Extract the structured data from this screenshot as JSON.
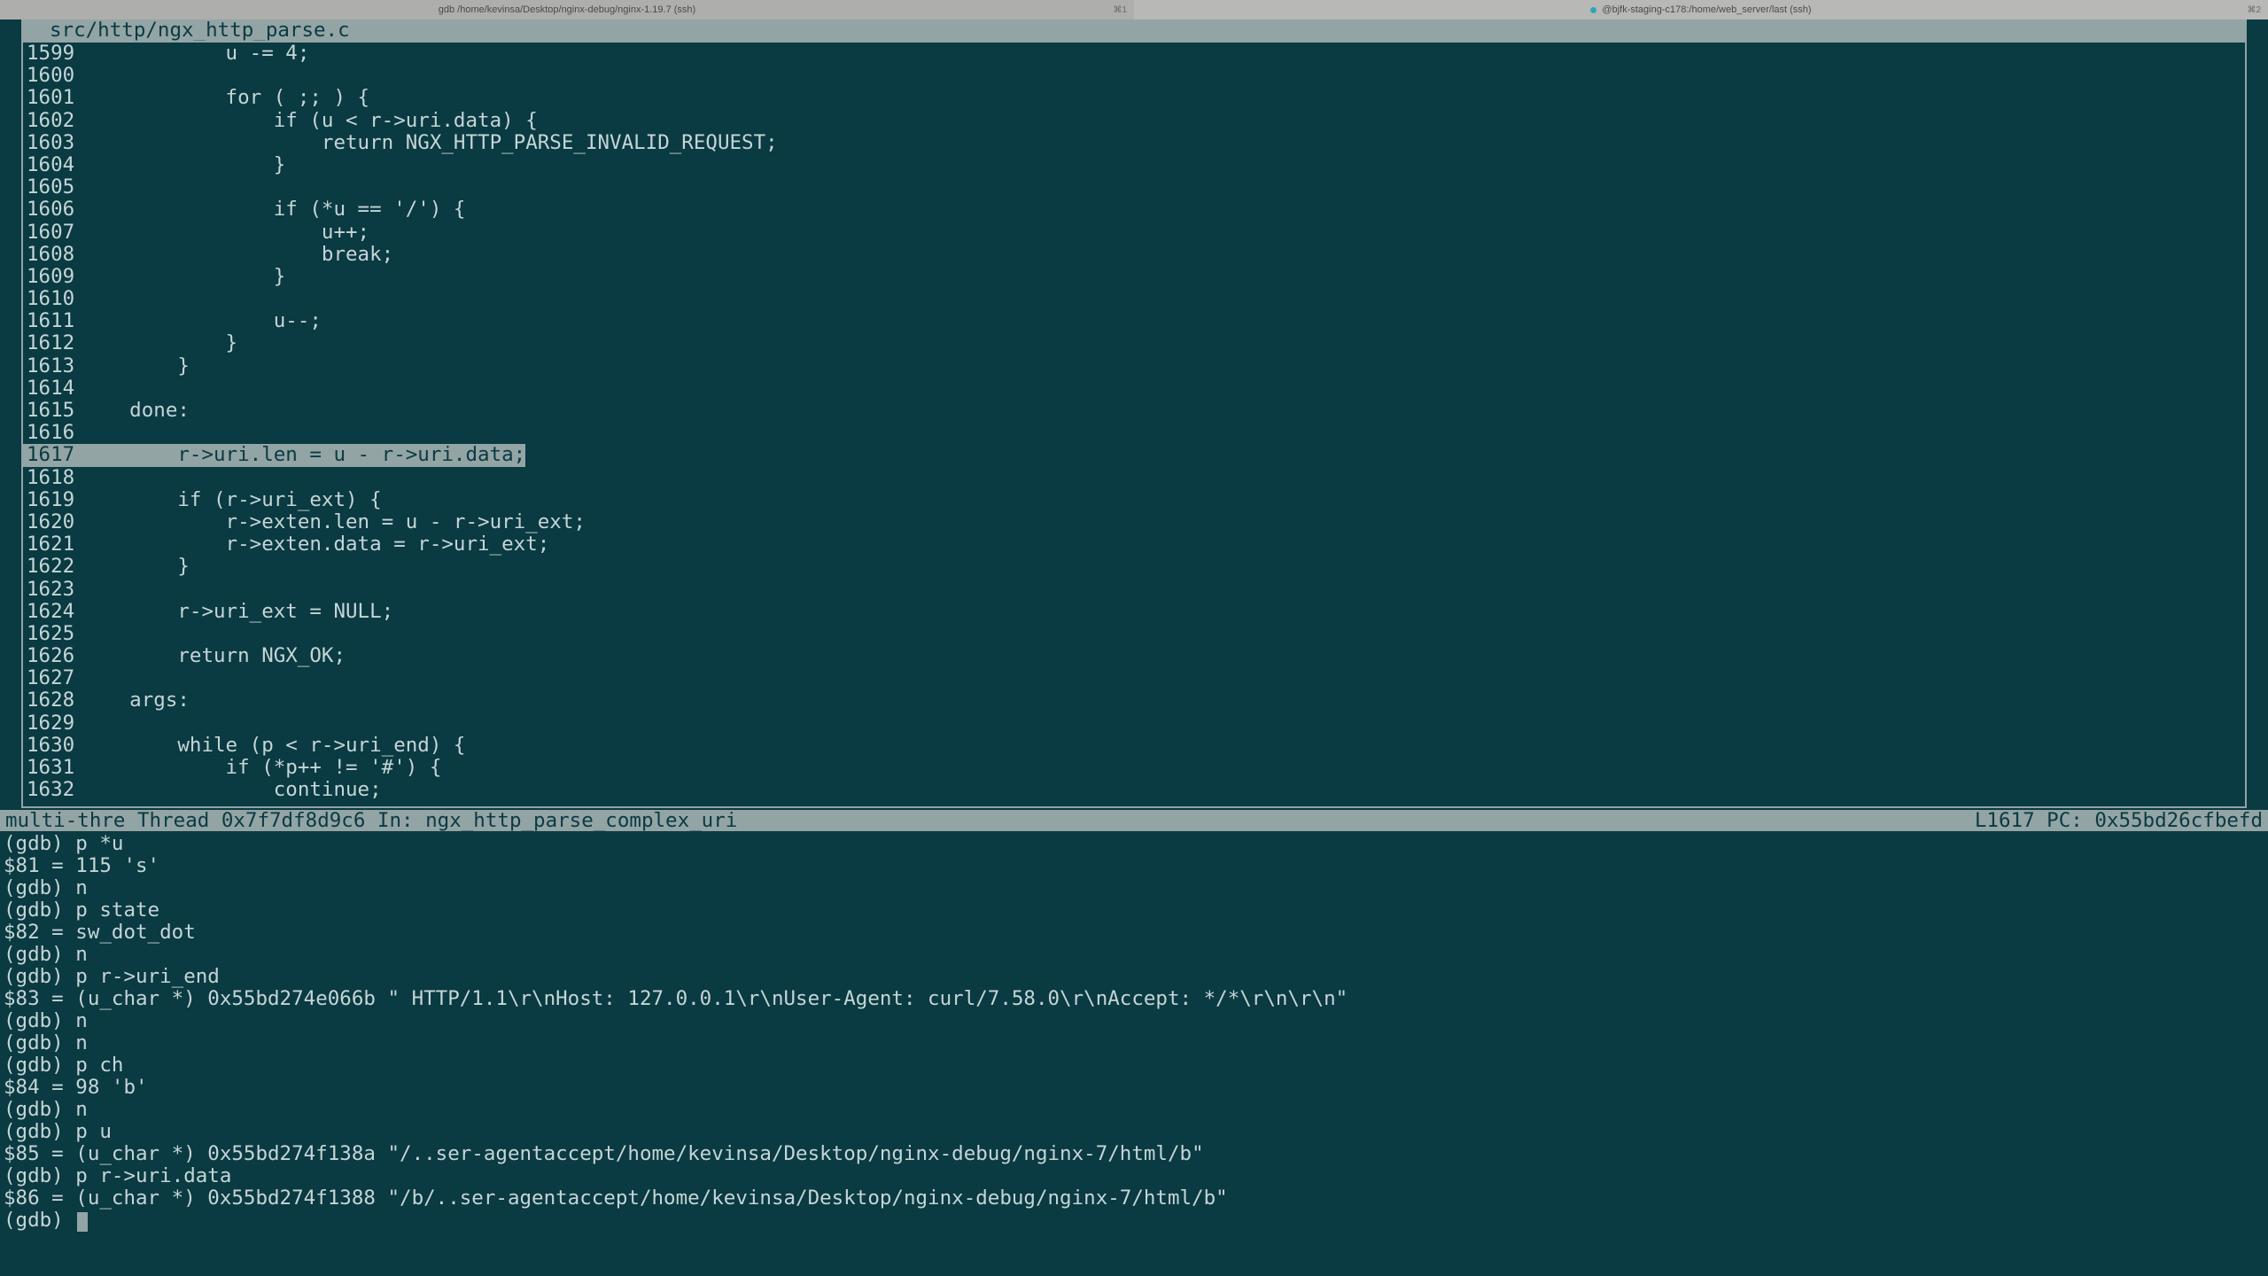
{
  "titlebar": {
    "tab1": {
      "label": "gdb  /home/kevinsa/Desktop/nginx-debug/nginx-1.19.7 (ssh)",
      "hotkey": "⌘1"
    },
    "tab2": {
      "label": "@bjfk-staging-c178:/home/web_server/last (ssh)",
      "hotkey": "⌘2"
    }
  },
  "source": {
    "path": "src/http/ngx_http_parse.c",
    "current_marker": ">",
    "lines": [
      {
        "num": "1599",
        "text": "            u -= 4;"
      },
      {
        "num": "1600",
        "text": ""
      },
      {
        "num": "1601",
        "text": "            for ( ;; ) {"
      },
      {
        "num": "1602",
        "text": "                if (u < r->uri.data) {"
      },
      {
        "num": "1603",
        "text": "                    return NGX_HTTP_PARSE_INVALID_REQUEST;"
      },
      {
        "num": "1604",
        "text": "                }"
      },
      {
        "num": "1605",
        "text": ""
      },
      {
        "num": "1606",
        "text": "                if (*u == '/') {"
      },
      {
        "num": "1607",
        "text": "                    u++;"
      },
      {
        "num": "1608",
        "text": "                    break;"
      },
      {
        "num": "1609",
        "text": "                }"
      },
      {
        "num": "1610",
        "text": ""
      },
      {
        "num": "1611",
        "text": "                u--;"
      },
      {
        "num": "1612",
        "text": "            }"
      },
      {
        "num": "1613",
        "text": "        }"
      },
      {
        "num": "1614",
        "text": ""
      },
      {
        "num": "1615",
        "text": "    done:"
      },
      {
        "num": "1616",
        "text": ""
      },
      {
        "num": "1617",
        "text": "        r->uri.len = u - r->uri.data;",
        "current": true
      },
      {
        "num": "1618",
        "text": ""
      },
      {
        "num": "1619",
        "text": "        if (r->uri_ext) {"
      },
      {
        "num": "1620",
        "text": "            r->exten.len = u - r->uri_ext;"
      },
      {
        "num": "1621",
        "text": "            r->exten.data = r->uri_ext;"
      },
      {
        "num": "1622",
        "text": "        }"
      },
      {
        "num": "1623",
        "text": ""
      },
      {
        "num": "1624",
        "text": "        r->uri_ext = NULL;"
      },
      {
        "num": "1625",
        "text": ""
      },
      {
        "num": "1626",
        "text": "        return NGX_OK;"
      },
      {
        "num": "1627",
        "text": ""
      },
      {
        "num": "1628",
        "text": "    args:"
      },
      {
        "num": "1629",
        "text": ""
      },
      {
        "num": "1630",
        "text": "        while (p < r->uri_end) {"
      },
      {
        "num": "1631",
        "text": "            if (*p++ != '#') {"
      },
      {
        "num": "1632",
        "text": "                continue;"
      }
    ]
  },
  "status": {
    "left": "multi-thre Thread 0x7f7df8d9c6 In: ngx_http_parse_complex_uri",
    "right": "L1617 PC: 0x55bd26cfbefd"
  },
  "console": [
    "(gdb) p *u",
    "$81 = 115 's'",
    "(gdb) n",
    "(gdb) p state",
    "$82 = sw_dot_dot",
    "(gdb) n",
    "(gdb) p r->uri_end",
    "$83 = (u_char *) 0x55bd274e066b \" HTTP/1.1\\r\\nHost: 127.0.0.1\\r\\nUser-Agent: curl/7.58.0\\r\\nAccept: */*\\r\\n\\r\\n\"",
    "(gdb) n",
    "(gdb) n",
    "(gdb) p ch",
    "$84 = 98 'b'",
    "(gdb) n",
    "(gdb) p u",
    "$85 = (u_char *) 0x55bd274f138a \"/..ser-agentaccept/home/kevinsa/Desktop/nginx-debug/nginx-7/html/b\"",
    "(gdb) p r->uri.data",
    "$86 = (u_char *) 0x55bd274f1388 \"/b/..ser-agentaccept/home/kevinsa/Desktop/nginx-debug/nginx-7/html/b\"",
    "(gdb) "
  ]
}
